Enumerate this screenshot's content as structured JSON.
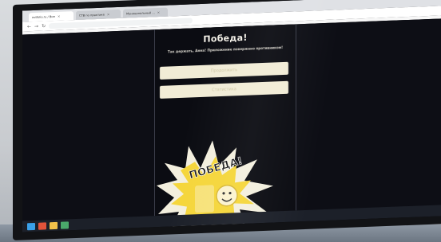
{
  "browser": {
    "tabs": [
      {
        "label": "notfolio.ru / Вин",
        "active": true
      },
      {
        "label": "СТВ по практике",
        "active": false
      },
      {
        "label": "Муниципальный ...",
        "active": false
      }
    ]
  },
  "game": {
    "title": "Победа!",
    "subtitle": "Так держать, Анна! Приложение повержено противником!",
    "button_primary": "Продолжить",
    "button_secondary": "Статистика",
    "art_text": "ПОБЕДА!"
  },
  "colors": {
    "background": "#0d0e15",
    "button": "#f1ecd6",
    "accent": "#f5d63b"
  },
  "icons": [
    "windows-start-icon",
    "browser-icon",
    "folder-icon",
    "app-icon"
  ]
}
